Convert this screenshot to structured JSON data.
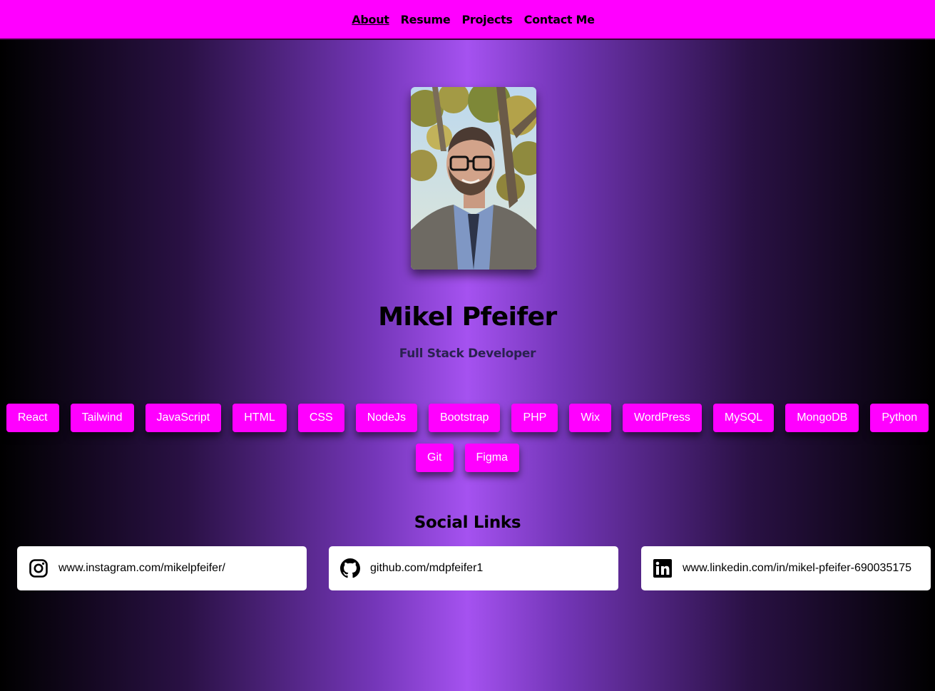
{
  "nav": {
    "items": [
      {
        "label": "About",
        "active": true
      },
      {
        "label": "Resume",
        "active": false
      },
      {
        "label": "Projects",
        "active": false
      },
      {
        "label": "Contact Me",
        "active": false
      }
    ]
  },
  "profile": {
    "name": "Mikel Pfeifer",
    "role": "Full Stack Developer"
  },
  "skills": {
    "row1": [
      "React",
      "Tailwind",
      "JavaScript",
      "HTML",
      "CSS",
      "NodeJs",
      "Bootstrap",
      "PHP",
      "Wix",
      "WordPress",
      "MySQL",
      "MongoDB",
      "Python"
    ],
    "row2": [
      "Git",
      "Figma"
    ]
  },
  "social": {
    "title": "Social Links",
    "links": [
      {
        "icon": "instagram-icon",
        "text": "www.instagram.com/mikelpfeifer/"
      },
      {
        "icon": "github-icon",
        "text": "github.com/mdpfeifer1"
      },
      {
        "icon": "linkedin-icon",
        "text": "www.linkedin.com/in/mikel-pfeifer-690035175"
      }
    ]
  },
  "colors": {
    "nav_background": "#ff00ff",
    "skill_background": "#ff00ff",
    "gradient_center": "#a552f0",
    "gradient_edge": "#000000"
  }
}
